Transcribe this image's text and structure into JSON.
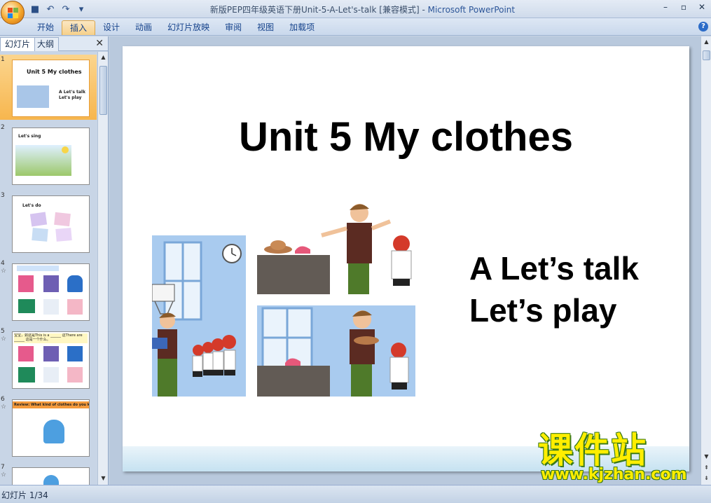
{
  "window": {
    "title_doc": "新版PEP四年级英语下册Unit-5-A-Let's-talk [兼容模式] - ",
    "title_app": "Microsoft PowerPoint",
    "controls": [
      "–",
      "▫",
      "✕"
    ]
  },
  "quick_access": [
    "save-icon",
    "undo-icon",
    "redo-icon",
    "customize-icon"
  ],
  "ribbon": {
    "tabs": [
      "开始",
      "插入",
      "设计",
      "动画",
      "幻灯片放映",
      "审阅",
      "视图",
      "加载项"
    ],
    "active_tab": "插入",
    "help": "?"
  },
  "side_pane": {
    "tabs": [
      "幻灯片",
      "大纲"
    ],
    "close": "✕"
  },
  "thumbnails": [
    {
      "num": "1",
      "title": "Unit 5 My clothes",
      "sub1": "A Let's talk",
      "sub2": "Let's play",
      "active": true
    },
    {
      "num": "2",
      "title": "Let's sing",
      "animated": false
    },
    {
      "num": "3",
      "title": "Let's do",
      "animated": false
    },
    {
      "num": "4",
      "star": "☆"
    },
    {
      "num": "5",
      "star": "☆",
      "text": "宝宝，如这是This is a ______ 这There are ______ 这是一个什么。"
    },
    {
      "num": "6",
      "star": "☆",
      "text": "Review: What kind of clothes do you know?"
    },
    {
      "num": "7",
      "star": "☆"
    }
  ],
  "slide": {
    "title": "Unit 5 My clothes",
    "subtitle_1": "A Let’s talk",
    "subtitle_2": "Let’s play"
  },
  "watermark": {
    "text": "课件站",
    "url": "www.kjzhan.com"
  },
  "status": {
    "text": "幻灯片 1/34"
  },
  "colors": {
    "ribbon_active": "#f6d08a",
    "thumb_active": "#f7b64e",
    "watermark_fill": "#ffee00",
    "watermark_outline": "#3a7a18"
  }
}
